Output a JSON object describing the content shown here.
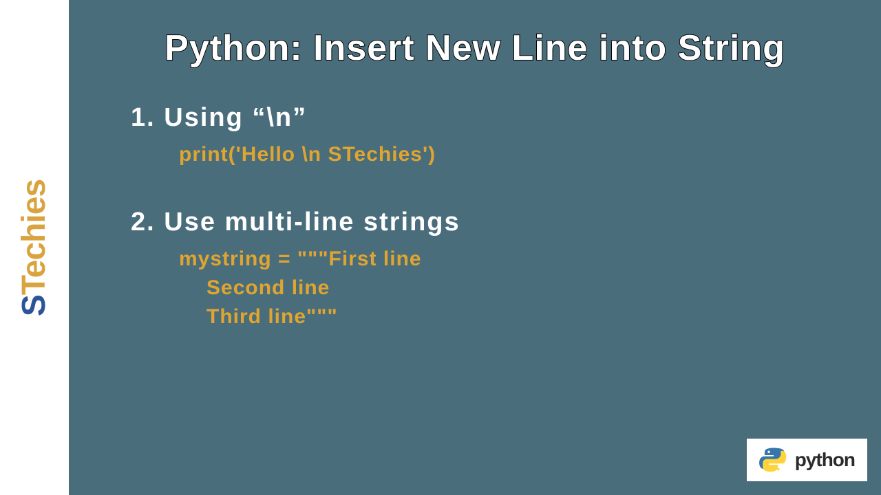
{
  "sidebar": {
    "logo_s": "S",
    "logo_rest": "Techies"
  },
  "title": "Python: Insert New Line into String",
  "items": [
    {
      "heading": "1. Using “\\n”",
      "code": [
        "print('Hello \\n STechies')"
      ]
    },
    {
      "heading": "2. Use multi-line strings",
      "code": [
        "mystring = \"\"\"First line",
        "Second line",
        "Third line\"\"\""
      ]
    }
  ],
  "badge": {
    "label": "python"
  }
}
